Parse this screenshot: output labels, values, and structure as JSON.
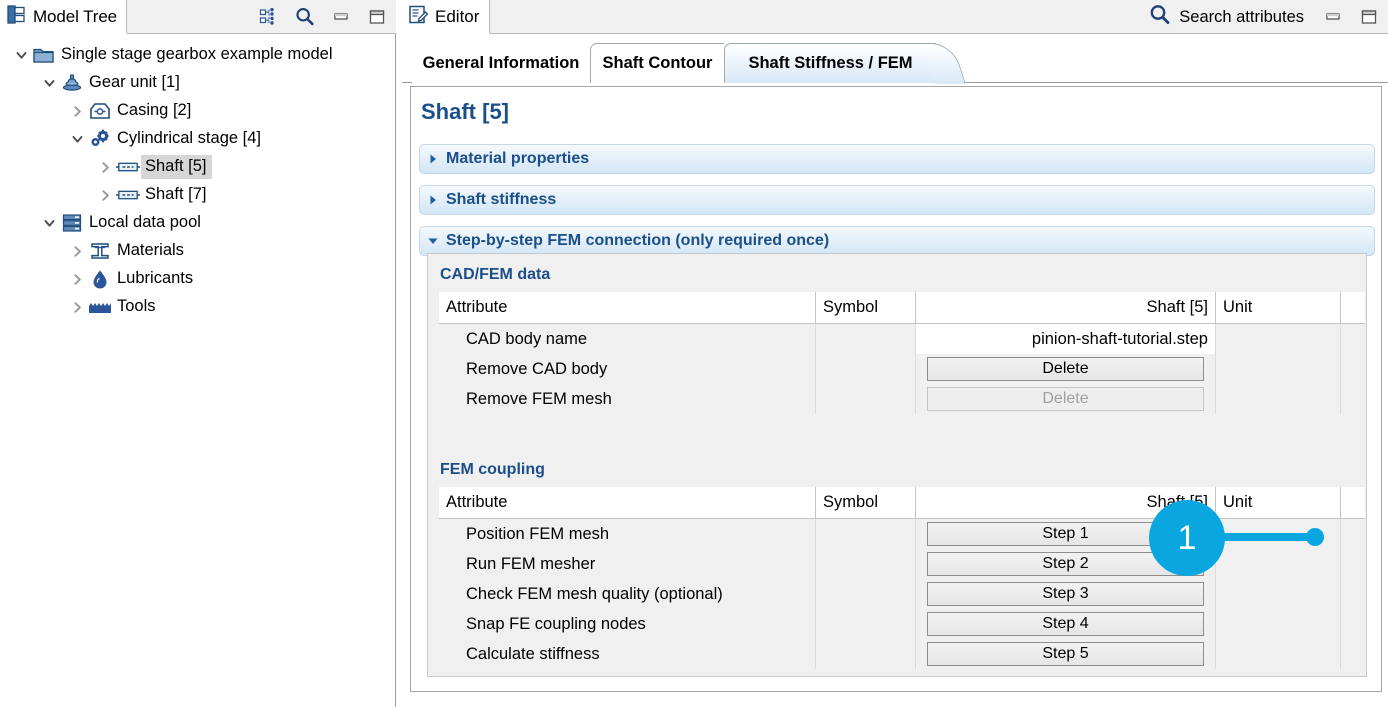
{
  "tree_panel": {
    "tab_label": "Model Tree",
    "icons": {
      "tab": "model-tree-icon",
      "link": "link-with-editor-icon",
      "search": "search-icon",
      "minimize": "minimize-icon",
      "maximize": "maximize-icon"
    },
    "items": [
      {
        "label": "Single stage gearbox example model",
        "indent": 0,
        "twist": "expanded",
        "icon": "folder-icon",
        "selected": false
      },
      {
        "label": "Gear unit [1]",
        "indent": 1,
        "twist": "expanded",
        "icon": "gear-unit-icon",
        "selected": false
      },
      {
        "label": "Casing [2]",
        "indent": 2,
        "twist": "collapsed",
        "icon": "casing-icon",
        "selected": false
      },
      {
        "label": "Cylindrical stage [4]",
        "indent": 2,
        "twist": "expanded",
        "icon": "cylindrical-stage-icon",
        "selected": false
      },
      {
        "label": "Shaft [5]",
        "indent": 3,
        "twist": "collapsed",
        "icon": "shaft-icon",
        "selected": true
      },
      {
        "label": "Shaft [7]",
        "indent": 3,
        "twist": "collapsed",
        "icon": "shaft-icon",
        "selected": false
      },
      {
        "label": "Local data pool",
        "indent": 1,
        "twist": "expanded",
        "icon": "data-pool-icon",
        "selected": false
      },
      {
        "label": "Materials",
        "indent": 2,
        "twist": "collapsed",
        "icon": "materials-icon",
        "selected": false
      },
      {
        "label": "Lubricants",
        "indent": 2,
        "twist": "collapsed",
        "icon": "lubricants-icon",
        "selected": false
      },
      {
        "label": "Tools",
        "indent": 2,
        "twist": "collapsed",
        "icon": "tools-icon",
        "selected": false
      }
    ]
  },
  "editor": {
    "tab_label": "Editor",
    "search_label": "Search attributes",
    "icons": {
      "tab": "editor-icon",
      "search": "search-icon",
      "minimize": "minimize-icon",
      "maximize": "maximize-icon"
    },
    "inner_tabs": [
      {
        "label": "General Information",
        "active": false
      },
      {
        "label": "Shaft Contour",
        "active": false
      },
      {
        "label": "Shaft Stiffness / FEM",
        "active": true
      }
    ],
    "page_title": "Shaft [5]",
    "sections": [
      {
        "label": "Material properties",
        "expanded": false
      },
      {
        "label": "Shaft stiffness",
        "expanded": false
      },
      {
        "label": "Step-by-step FEM connection (only required once)",
        "expanded": true
      }
    ],
    "cadfem": {
      "group_title": "CAD/FEM data",
      "headers": {
        "attribute": "Attribute",
        "symbol": "Symbol",
        "value": "Shaft [5]",
        "unit": "Unit"
      },
      "rows": [
        {
          "attribute": "CAD body name",
          "symbol": "",
          "value": "pinion-shaft-tutorial.step",
          "value_kind": "text",
          "unit": ""
        },
        {
          "attribute": "Remove CAD body",
          "symbol": "",
          "value": "Delete",
          "value_kind": "button",
          "disabled": false,
          "unit": ""
        },
        {
          "attribute": "Remove FEM mesh",
          "symbol": "",
          "value": "Delete",
          "value_kind": "button",
          "disabled": true,
          "unit": ""
        }
      ]
    },
    "coupling": {
      "group_title": "FEM coupling",
      "headers": {
        "attribute": "Attribute",
        "symbol": "Symbol",
        "value": "Shaft [5]",
        "unit": "Unit"
      },
      "rows": [
        {
          "attribute": "Position FEM mesh",
          "symbol": "",
          "value": "Step 1",
          "value_kind": "button",
          "disabled": false,
          "unit": ""
        },
        {
          "attribute": "Run FEM mesher",
          "symbol": "",
          "value": "Step 2",
          "value_kind": "button",
          "disabled": false,
          "unit": ""
        },
        {
          "attribute": "Check FEM mesh quality (optional)",
          "symbol": "",
          "value": "Step 3",
          "value_kind": "button",
          "disabled": false,
          "unit": ""
        },
        {
          "attribute": "Snap FE coupling nodes",
          "symbol": "",
          "value": "Step 4",
          "value_kind": "button",
          "disabled": false,
          "unit": ""
        },
        {
          "attribute": "Calculate stiffness",
          "symbol": "",
          "value": "Step 5",
          "value_kind": "button",
          "disabled": false,
          "unit": ""
        }
      ]
    }
  },
  "callout": {
    "number": "1",
    "color": "#0aa6e0",
    "points_to": "Step 1"
  },
  "colors": {
    "accent_blue": "#1b4f8a",
    "icon_blue": "#2a5699",
    "callout": "#0aa6e0",
    "panel_gray": "#f0f0f0",
    "section_gradient_top": "#f5f9fd",
    "section_gradient_bottom": "#d3e6f6"
  }
}
